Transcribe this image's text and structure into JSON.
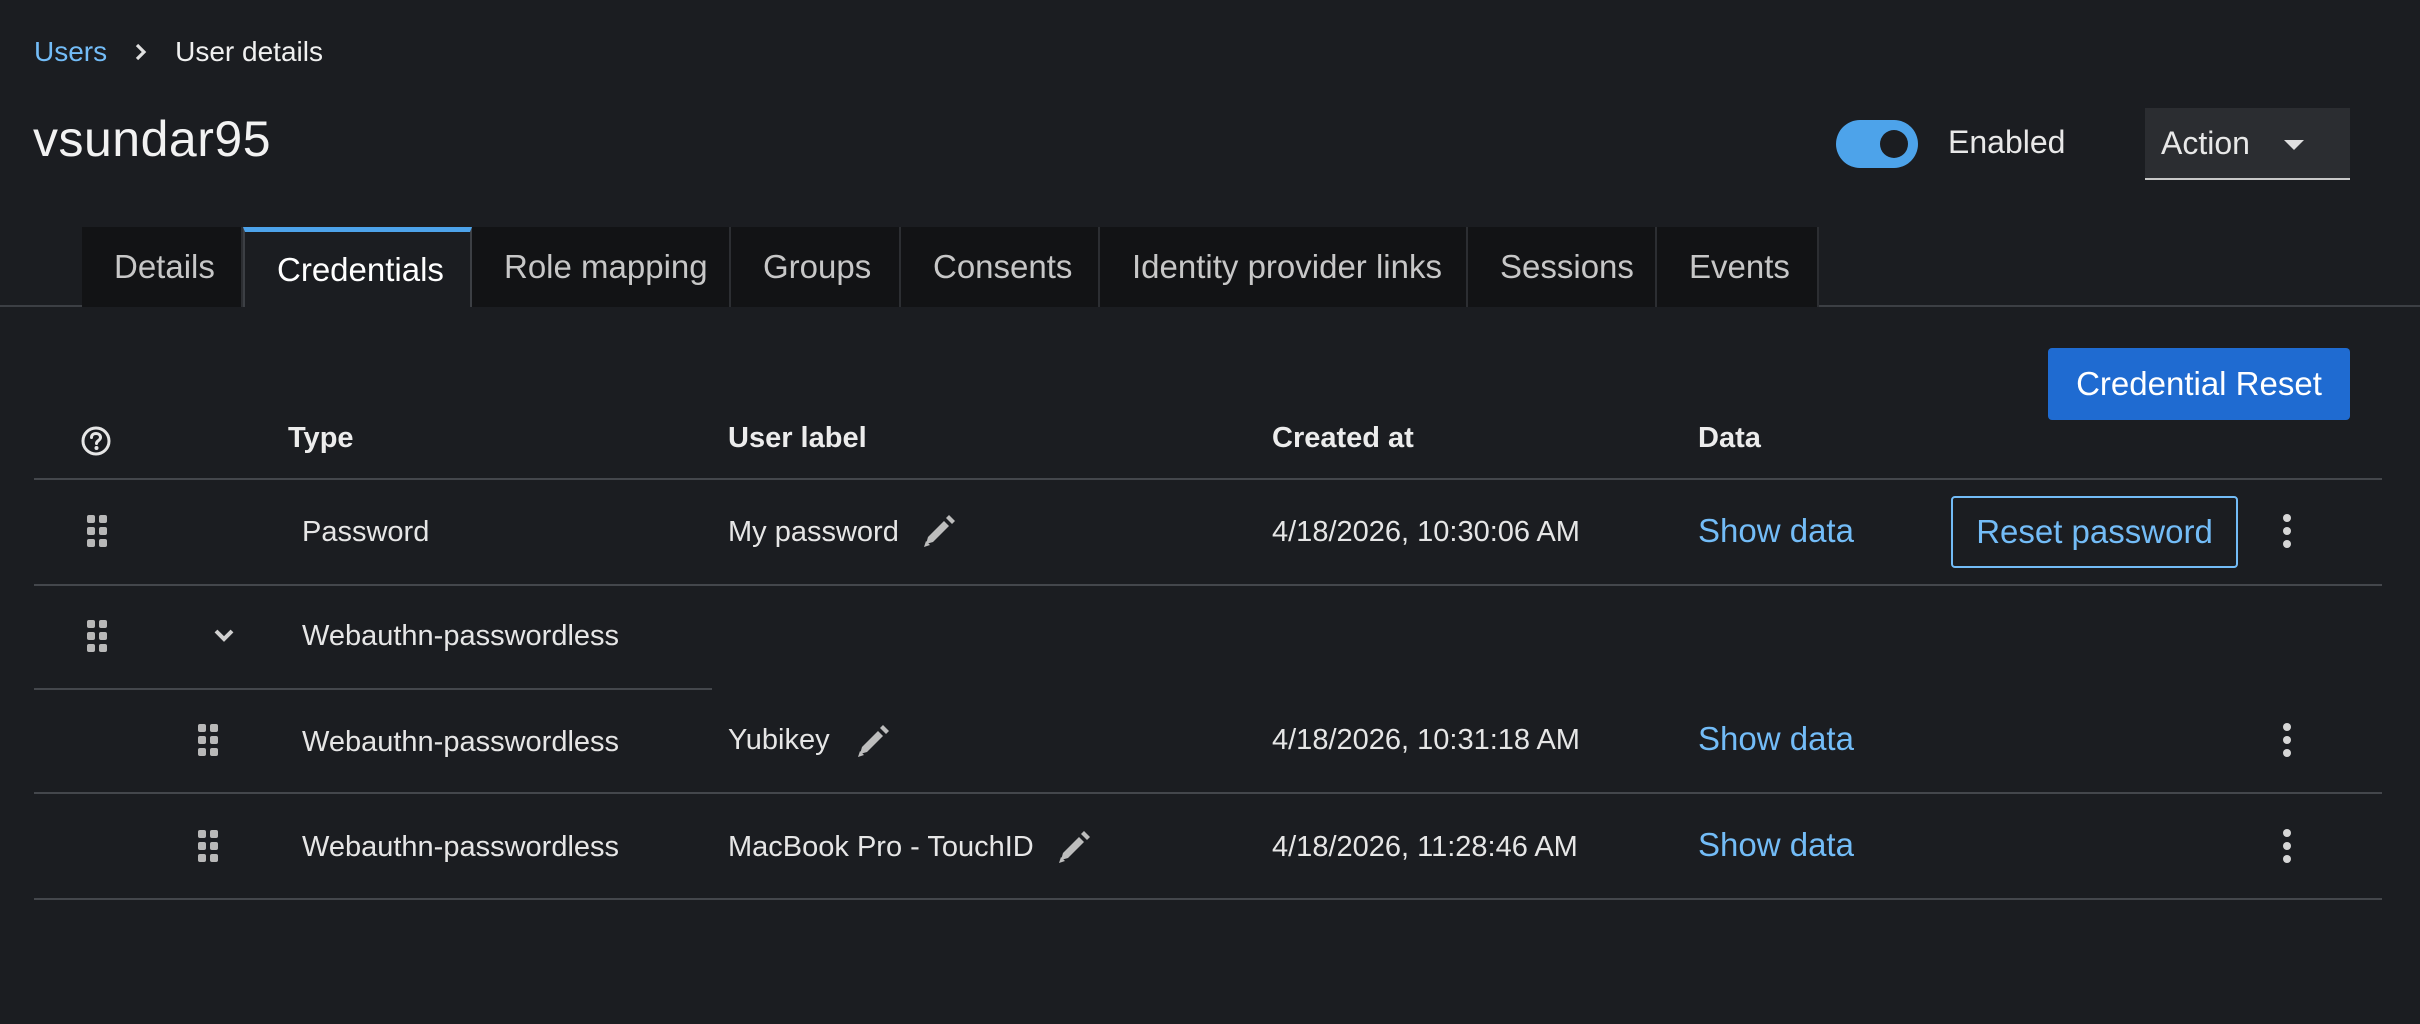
{
  "breadcrumb": {
    "parent": "Users",
    "current": "User details"
  },
  "page_title": "vsundar95",
  "header": {
    "toggle_label": "Enabled",
    "toggle_on": true,
    "action_label": "Action"
  },
  "tabs": [
    {
      "label": "Details",
      "active": false
    },
    {
      "label": "Credentials",
      "active": true
    },
    {
      "label": "Role mapping",
      "active": false
    },
    {
      "label": "Groups",
      "active": false
    },
    {
      "label": "Consents",
      "active": false
    },
    {
      "label": "Identity provider links",
      "active": false
    },
    {
      "label": "Sessions",
      "active": false
    },
    {
      "label": "Events",
      "active": false
    }
  ],
  "toolbar": {
    "credential_reset_label": "Credential Reset"
  },
  "table": {
    "columns": {
      "type": "Type",
      "user_label": "User label",
      "created_at": "Created at",
      "data": "Data"
    },
    "rows": [
      {
        "type": "Password",
        "user_label": "My password",
        "created_at": "4/18/2026, 10:30:06 AM",
        "data_link": "Show data",
        "action_label": "Reset password"
      },
      {
        "type": "Webauthn-passwordless",
        "group": true
      },
      {
        "type": "Webauthn-passwordless",
        "user_label": "Yubikey",
        "created_at": "4/18/2026, 10:31:18 AM",
        "data_link": "Show data"
      },
      {
        "type": "Webauthn-passwordless",
        "user_label": "MacBook Pro - TouchID",
        "created_at": "4/18/2026, 11:28:46 AM",
        "data_link": "Show data"
      }
    ]
  },
  "icons": {
    "help": "help-circle-icon",
    "drag": "drag-handle-icon",
    "edit": "pencil-icon",
    "kebab": "kebab-menu-icon",
    "chevron": "chevron-down-icon",
    "breadcrumb_sep": "chevron-right-icon"
  },
  "colors": {
    "accent": "#4da3ea",
    "link": "#73bcf7",
    "primary": "#1f6bd1",
    "background": "#1b1d21"
  }
}
